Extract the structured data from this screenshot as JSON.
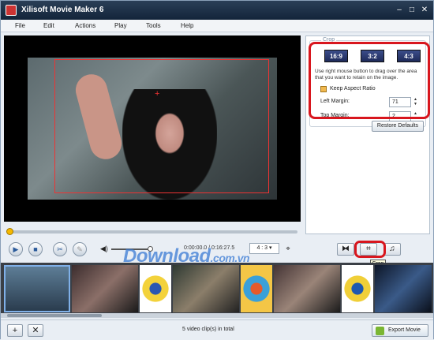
{
  "window": {
    "title": "Xilisoft Movie Maker 6",
    "minimize": "–",
    "maximize": "□",
    "close": "✕"
  },
  "menu": [
    "File",
    "Edit",
    "Actions",
    "Play",
    "Tools",
    "Help"
  ],
  "player": {
    "time": "0:00:00.0 / 0:16:27.5",
    "aspect": "4 : 3 ▾",
    "progress": 0.0
  },
  "crop": {
    "group_title": "Crop",
    "ratios": [
      "16:9",
      "3:2",
      "4:3"
    ],
    "hint": "Use right mouse button to drag over the area that you want to retain on the image.",
    "keep_aspect_label": "Keep Aspect Ratio",
    "keep_aspect_checked": true,
    "left_margin_label": "Left Margin:",
    "left_margin_value": "71",
    "top_margin_label": "Top Margin:",
    "top_margin_value": "2",
    "restore_label": "Restore Defaults"
  },
  "edit_tabs": {
    "tooltip": "Crop"
  },
  "watermark": {
    "main": "Download",
    "suffix": ".com.vn"
  },
  "status": {
    "clips_text": "5 video clip(s) in total",
    "export_label": "Export Movie"
  },
  "colors": {
    "highlight": "#d8161e",
    "accent": "#2a5a9a"
  }
}
